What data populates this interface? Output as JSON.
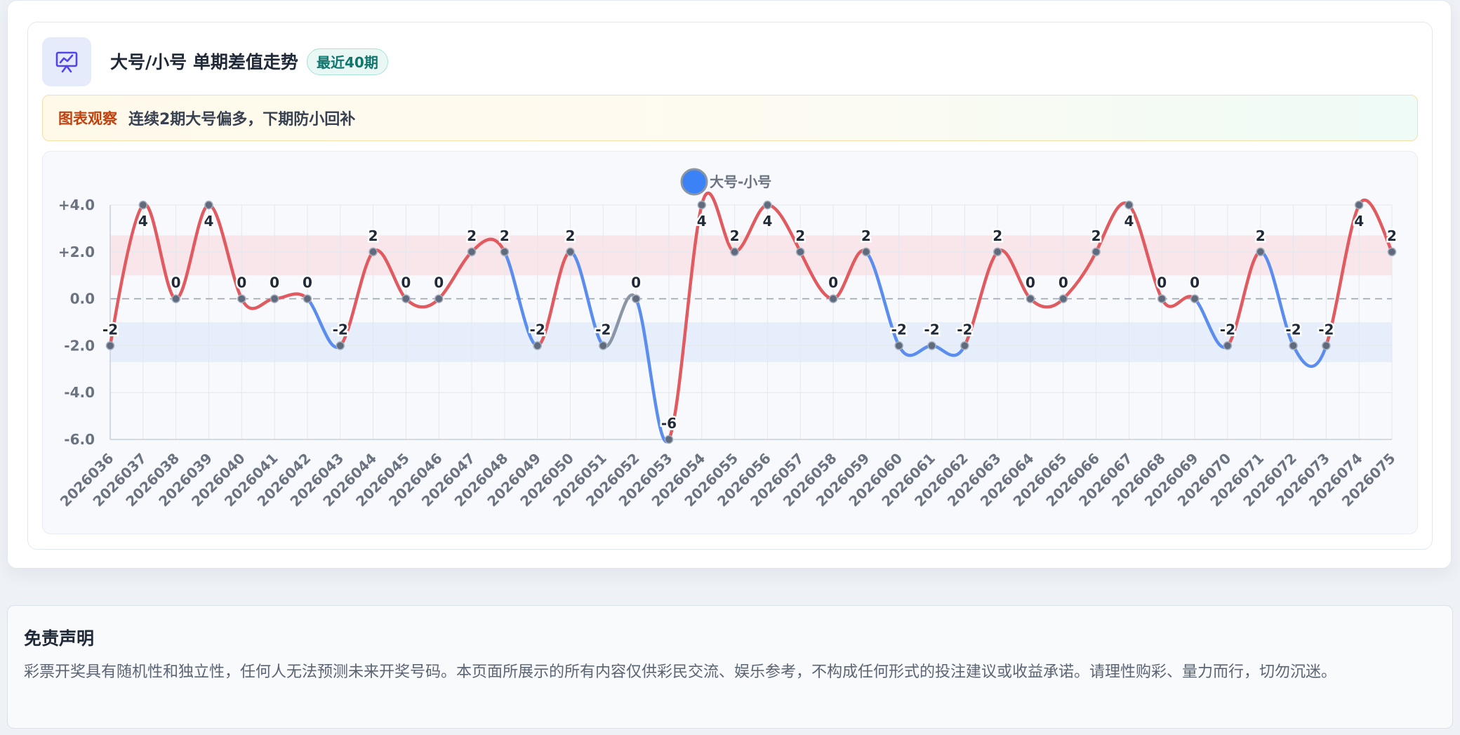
{
  "card": {
    "title": "大号/小号 单期差值走势",
    "badge": "最近40期",
    "icon": "chart-presentation-icon",
    "insight_tag": "图表观察",
    "insight_text": "连续2期大号偏多，下期防小回补"
  },
  "chart_data": {
    "type": "line",
    "title": "",
    "xlabel": "",
    "ylabel": "",
    "ylim": [
      -6,
      4
    ],
    "yticks": [
      4,
      2,
      0,
      -2,
      -4,
      -6
    ],
    "ytick_labels": [
      "+4.0",
      "+2.0",
      "0.0",
      "-2.0",
      "-4.0",
      "-6.0"
    ],
    "categories": [
      "2026036",
      "2026037",
      "2026038",
      "2026039",
      "2026040",
      "2026041",
      "2026042",
      "2026043",
      "2026044",
      "2026045",
      "2026046",
      "2026047",
      "2026048",
      "2026049",
      "2026050",
      "2026051",
      "2026052",
      "2026053",
      "2026054",
      "2026055",
      "2026056",
      "2026057",
      "2026058",
      "2026059",
      "2026060",
      "2026061",
      "2026062",
      "2026063",
      "2026064",
      "2026065",
      "2026066",
      "2026067",
      "2026068",
      "2026069",
      "2026070",
      "2026071",
      "2026072",
      "2026073",
      "2026074",
      "2026075"
    ],
    "series": [
      {
        "name": "大号-小号",
        "values": [
          -2,
          4,
          0,
          4,
          0,
          0,
          0,
          -2,
          2,
          0,
          0,
          2,
          2,
          -2,
          2,
          -2,
          0,
          -6,
          4,
          2,
          4,
          2,
          0,
          2,
          -2,
          -2,
          -2,
          2,
          0,
          0,
          2,
          4,
          0,
          0,
          -2,
          2,
          -2,
          -2,
          4,
          2
        ]
      }
    ],
    "legend": "top-center",
    "grid": true,
    "bands": [
      {
        "from": 1,
        "to": 2.7,
        "color": "#f8e6ea"
      },
      {
        "from": -2.7,
        "to": -1,
        "color": "#e7eefb"
      }
    ],
    "colors": {
      "up": "#e05a5f",
      "down": "#5b8def",
      "flat": "#8a95a5",
      "legend": "#3b82f6"
    }
  },
  "disclaimer": {
    "title": "免责声明",
    "text": "彩票开奖具有随机性和独立性，任何人无法预测未来开奖号码。本页面所展示的所有内容仅供彩民交流、娱乐参考，不构成任何形式的投注建议或收益承诺。请理性购彩、量力而行，切勿沉迷。"
  }
}
